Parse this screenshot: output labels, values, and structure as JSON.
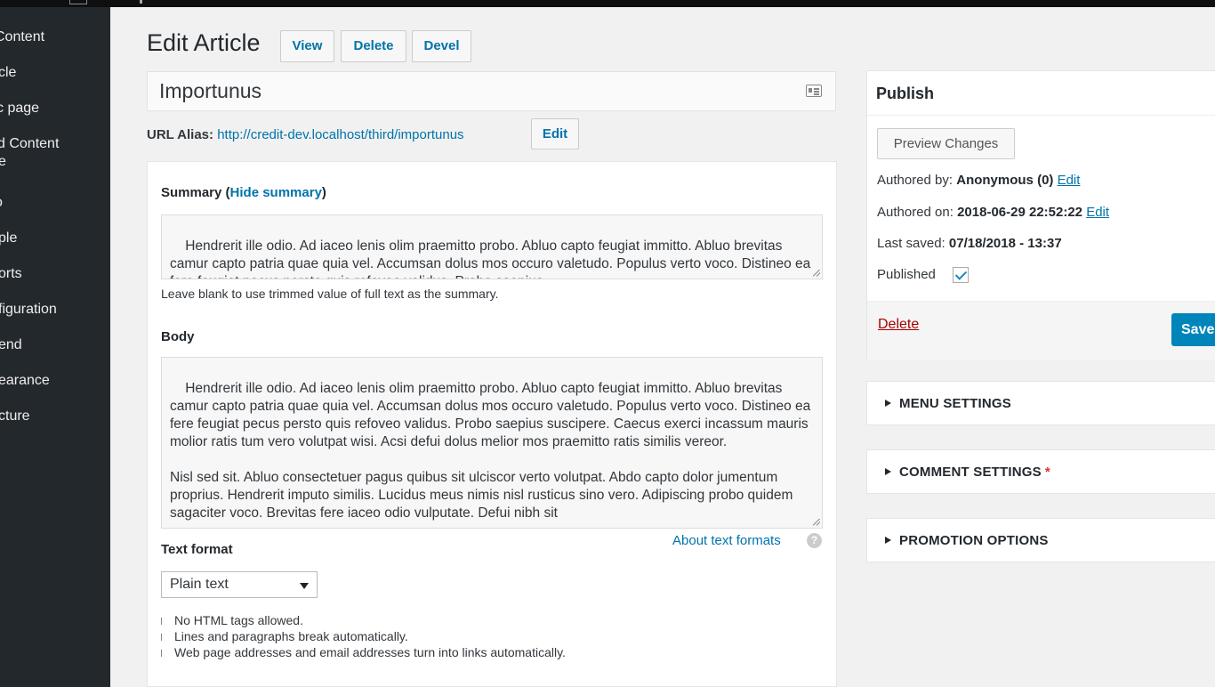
{
  "sidebar": {
    "items": [
      {
        "label": "Content"
      },
      {
        "label": "cle"
      },
      {
        "label": "c page"
      },
      {
        "label": "d Content"
      },
      {
        "label": "e"
      },
      {
        "label": "o"
      },
      {
        "label": "ple"
      },
      {
        "label": "orts"
      },
      {
        "label": "figuration"
      },
      {
        "label": "end"
      },
      {
        "label": "earance"
      },
      {
        "label": "cture"
      }
    ]
  },
  "header": {
    "title": "Edit Article",
    "buttons": {
      "view": "View",
      "delete": "Delete",
      "devel": "Devel"
    }
  },
  "title_field": {
    "value": "Importunus"
  },
  "url_alias": {
    "label": "URL Alias:",
    "url": "http://credit-dev.localhost/third/importunus",
    "edit": "Edit"
  },
  "summary": {
    "label": "Summary (",
    "hide_link": "Hide summary",
    "label_end": ")",
    "text": "Hendrerit ille odio. Ad iaceo lenis olim praemitto probo. Abluo capto feugiat immitto. Abluo brevitas camur capto patria quae quia vel. Accumsan dolus mos occuro valetudo. Populus verto voco. Distineo ea fere feugiat pecus persto quis refoveo validus. Probo saepius",
    "help": "Leave blank to use trimmed value of full text as the summary."
  },
  "body": {
    "label": "Body",
    "text": "Hendrerit ille odio. Ad iaceo lenis olim praemitto probo. Abluo capto feugiat immitto. Abluo brevitas camur capto patria quae quia vel. Accumsan dolus mos occuro valetudo. Populus verto voco. Distineo ea fere feugiat pecus persto quis refoveo validus. Probo saepius suscipere. Caecus exerci incassum mauris molior ratis tum vero volutpat wisi. Acsi defui dolus melior mos praemitto ratis similis vereor.\n\nNisl sed sit. Abluo consectetuer pagus quibus sit ulciscor verto volutpat. Abdo capto dolor jumentum proprius. Hendrerit imputo similis. Lucidus meus nimis nisl rusticus sino vero. Adipiscing probo quidem sagaciter voco. Brevitas fere iaceo odio vulputate. Defui nibh sit"
  },
  "text_format": {
    "about_link": "About text formats",
    "help_icon": "question-icon",
    "label": "Text format",
    "selected": "Plain text",
    "tips": [
      "No HTML tags allowed.",
      "Lines and paragraphs break automatically.",
      "Web page addresses and email addresses turn into links automatically."
    ]
  },
  "publish": {
    "title": "Publish",
    "preview": "Preview Changes",
    "authored_by_label": "Authored by:",
    "authored_by_value": "Anonymous (0)",
    "authored_on_label": "Authored on:",
    "authored_on_value": "2018-06-29 22:52:22",
    "edit_link": "Edit",
    "last_saved_label": "Last saved:",
    "last_saved_value": "07/18/2018 - 13:37",
    "published_label": "Published",
    "published": true,
    "delete": "Delete",
    "save": "Save"
  },
  "settings_boxes": {
    "menu": "MENU SETTINGS",
    "comment": "COMMENT SETTINGS",
    "comment_required": "*",
    "promotion": "PROMOTION OPTIONS"
  },
  "colors": {
    "link": "#0073aa",
    "sidebar_bg": "#23282d",
    "primary_button": "#0085ba",
    "delete": "#aa0000",
    "required": "#dc3232"
  }
}
